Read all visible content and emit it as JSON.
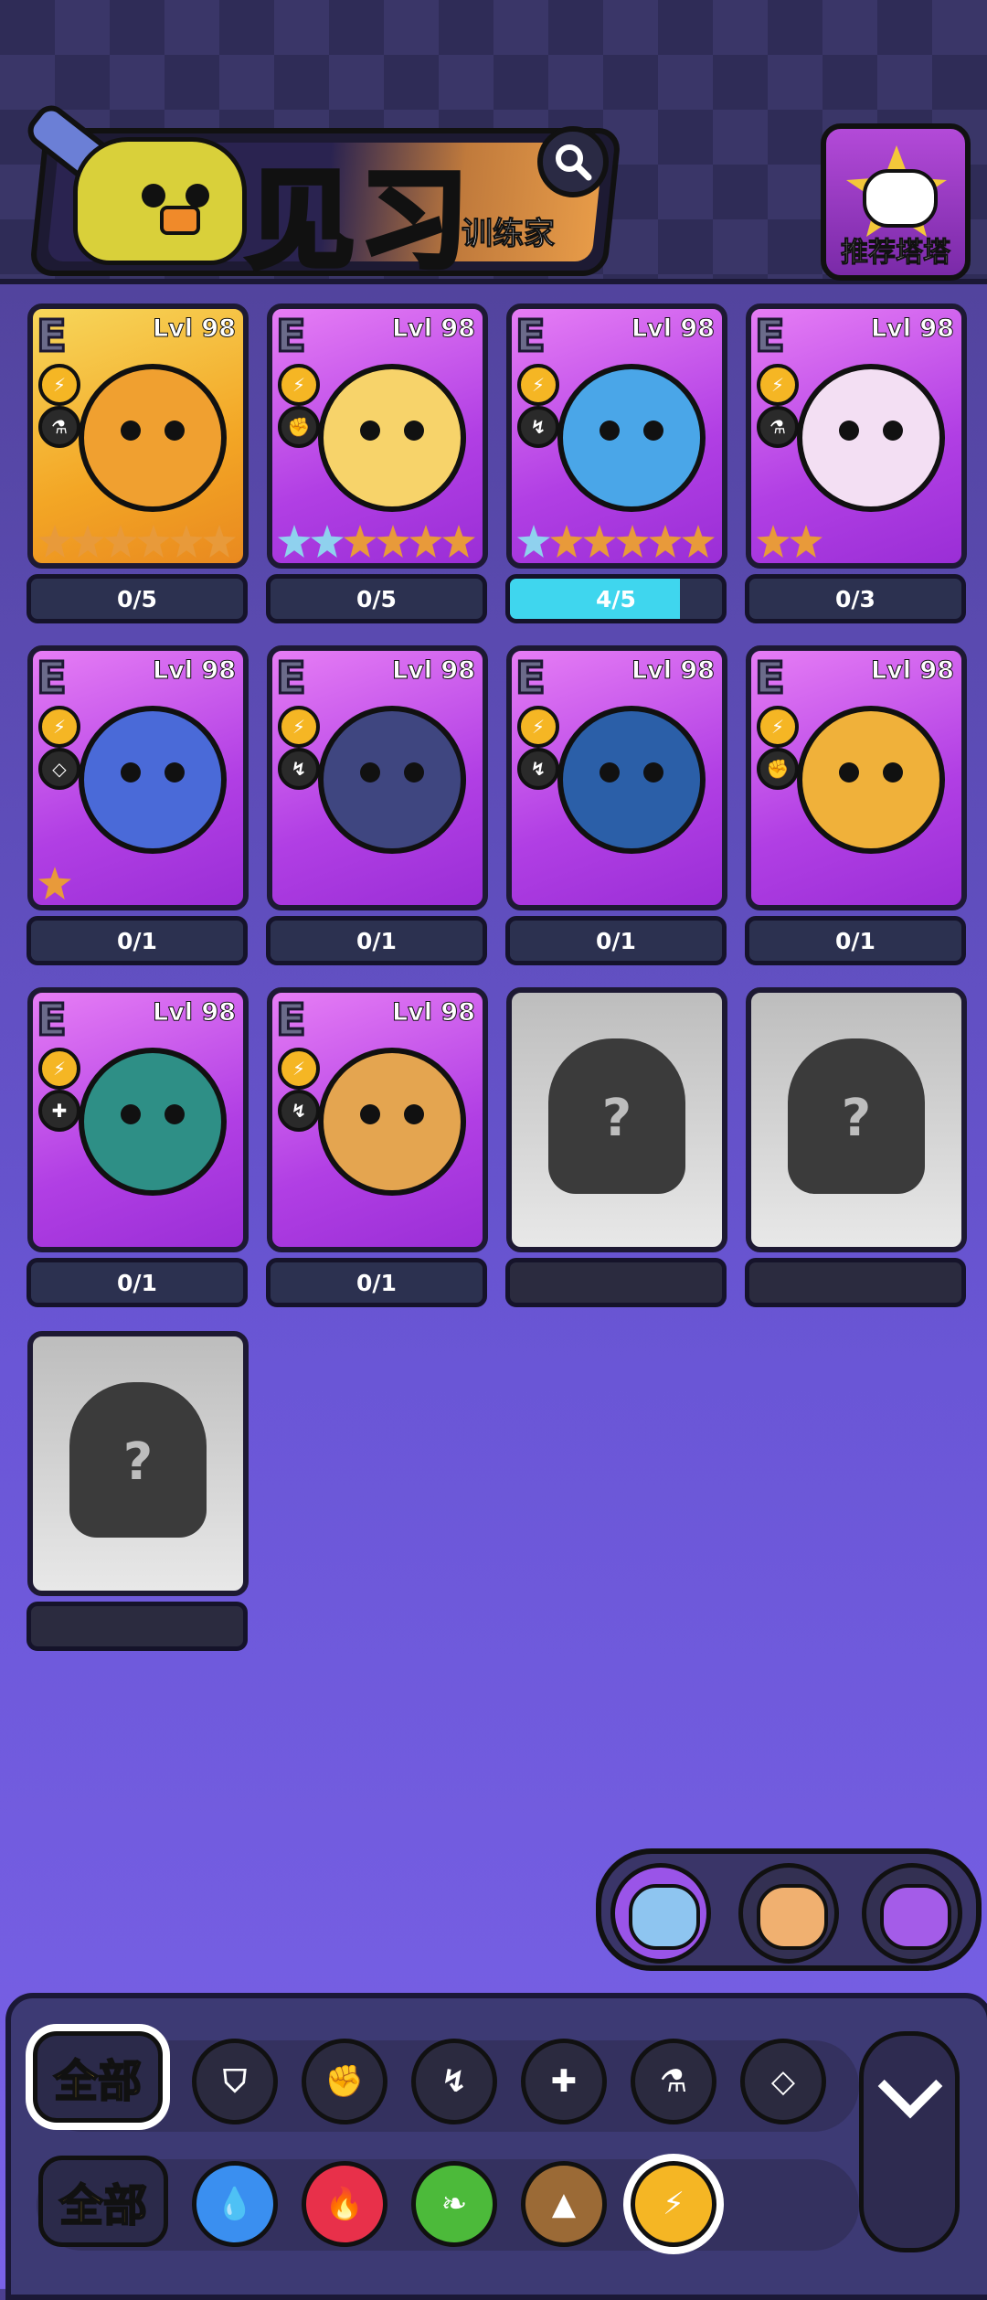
{
  "header": {
    "title": "见习",
    "subtitle": "训练家",
    "recommend_label": "推荐塔塔"
  },
  "cards": [
    {
      "rank": "E",
      "level": "Lvl 98",
      "element": "⚡",
      "class": "⚗",
      "stars_filled": 6,
      "stars_blue": 0,
      "progress": "0/5",
      "fill": 0.0,
      "color": "#f0a030",
      "frame": "gold"
    },
    {
      "rank": "E",
      "level": "Lvl 98",
      "element": "⚡",
      "class": "✊",
      "stars_filled": 4,
      "stars_blue": 2,
      "progress": "0/5",
      "fill": 0.0,
      "color": "#f7d36a",
      "frame": "purple"
    },
    {
      "rank": "E",
      "level": "Lvl 98",
      "element": "⚡",
      "class": "↯",
      "stars_filled": 5,
      "stars_blue": 1,
      "progress": "4/5",
      "fill": 0.8,
      "color": "#4aa6e8",
      "frame": "purple"
    },
    {
      "rank": "E",
      "level": "Lvl 98",
      "element": "⚡",
      "class": "⚗",
      "stars_filled": 2,
      "stars_blue": 0,
      "progress": "0/3",
      "fill": 0.0,
      "color": "#f3dff3",
      "frame": "purple"
    },
    {
      "rank": "E",
      "level": "Lvl 98",
      "element": "⚡",
      "class": "◇",
      "stars_filled": 1,
      "stars_blue": 0,
      "progress": "0/1",
      "fill": 0.0,
      "color": "#4a6ad8",
      "frame": "purple"
    },
    {
      "rank": "E",
      "level": "Lvl 98",
      "element": "⚡",
      "class": "↯",
      "stars_filled": 0,
      "stars_blue": 0,
      "progress": "0/1",
      "fill": 0.0,
      "color": "#3f4680",
      "frame": "purple"
    },
    {
      "rank": "E",
      "level": "Lvl 98",
      "element": "⚡",
      "class": "↯",
      "stars_filled": 0,
      "stars_blue": 0,
      "progress": "0/1",
      "fill": 0.0,
      "color": "#2b5fa8",
      "frame": "purple"
    },
    {
      "rank": "E",
      "level": "Lvl 98",
      "element": "⚡",
      "class": "✊",
      "stars_filled": 0,
      "stars_blue": 0,
      "progress": "0/1",
      "fill": 0.0,
      "color": "#f0b13a",
      "frame": "purple"
    },
    {
      "rank": "E",
      "level": "Lvl 98",
      "element": "⚡",
      "class": "✚",
      "stars_filled": 0,
      "stars_blue": 0,
      "progress": "0/1",
      "fill": 0.0,
      "color": "#2e8f86",
      "frame": "purple"
    },
    {
      "rank": "E",
      "level": "Lvl 98",
      "element": "⚡",
      "class": "↯",
      "stars_filled": 0,
      "stars_blue": 0,
      "progress": "0/1",
      "fill": 0.0,
      "color": "#e4a550",
      "frame": "purple"
    }
  ],
  "locked_cards": [
    {
      "mark": "?"
    },
    {
      "mark": "?"
    },
    {
      "mark": "?"
    }
  ],
  "switcher": {
    "selected": 0,
    "colors": [
      "#8ec5f0",
      "#f0b070",
      "#a45ce8"
    ]
  },
  "filters": {
    "all_label_1": "全部",
    "all_label_2": "全部",
    "class_icons": [
      {
        "name": "shield-icon",
        "glyph": "⛉"
      },
      {
        "name": "fist-icon",
        "glyph": "✊"
      },
      {
        "name": "kick-icon",
        "glyph": "↯"
      },
      {
        "name": "cross-icon",
        "glyph": "✚"
      },
      {
        "name": "flask-icon",
        "glyph": "⚗"
      },
      {
        "name": "diamond-icon",
        "glyph": "◇"
      }
    ],
    "element_icons": [
      {
        "name": "water-icon",
        "glyph": "💧",
        "color": "#3a8ff0"
      },
      {
        "name": "fire-icon",
        "glyph": "🔥",
        "color": "#e8304a"
      },
      {
        "name": "leaf-icon",
        "glyph": "❧",
        "color": "#4cba3a"
      },
      {
        "name": "earth-icon",
        "glyph": "▲",
        "color": "#9b6a36"
      },
      {
        "name": "lightning-icon",
        "glyph": "⚡",
        "color": "#f5b624"
      }
    ],
    "active_element": 4
  }
}
